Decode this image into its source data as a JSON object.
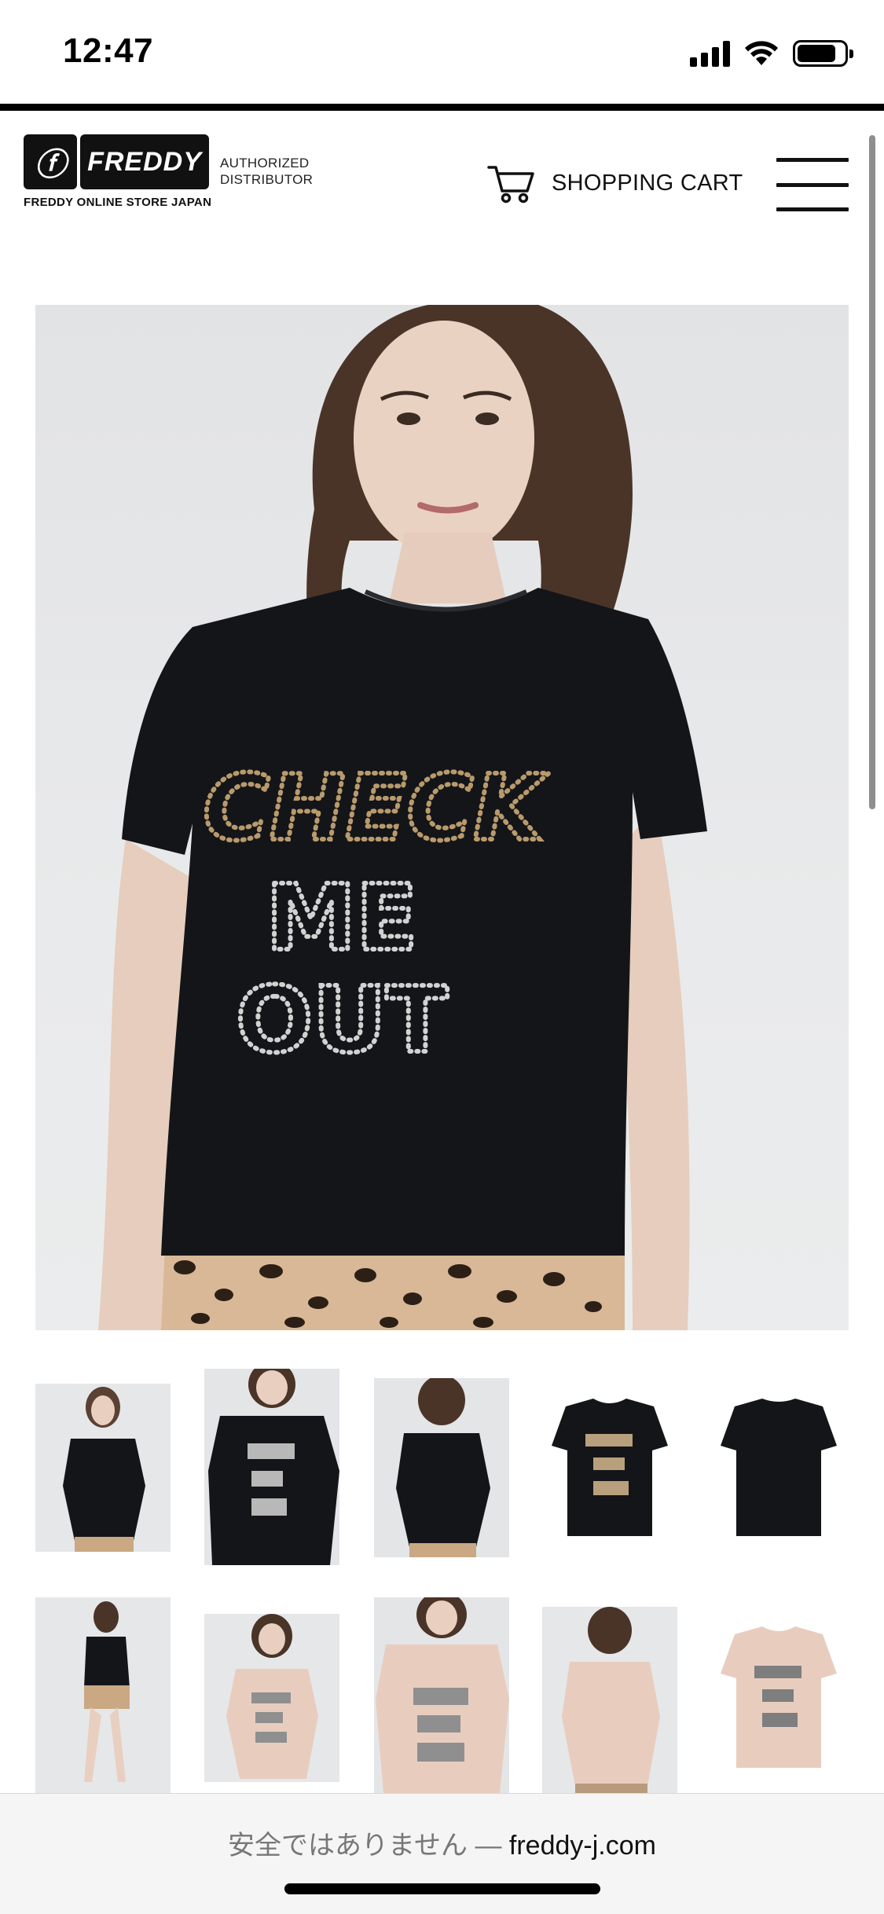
{
  "status_bar": {
    "time": "12:47"
  },
  "header": {
    "logo_text": "FREDDY",
    "logo_subtitle": "FREDDY ONLINE STORE JAPAN",
    "authorized_line1": "AUTHORIZED",
    "authorized_line2": "DISTRIBUTOR",
    "cart_label": "SHOPPING CART",
    "menu_icon": "hamburger-menu-icon",
    "cart_icon": "shopping-cart-icon"
  },
  "product": {
    "main_image_print": [
      "CHECK",
      "ME",
      "OUT"
    ],
    "thumbnails": [
      {
        "variant": "black",
        "view": "model-front"
      },
      {
        "variant": "black",
        "view": "model-closeup"
      },
      {
        "variant": "black",
        "view": "model-back"
      },
      {
        "variant": "black",
        "view": "product-front"
      },
      {
        "variant": "black",
        "view": "product-back"
      },
      {
        "variant": "black",
        "view": "model-full"
      },
      {
        "variant": "pink",
        "view": "model-front"
      },
      {
        "variant": "pink",
        "view": "model-closeup"
      },
      {
        "variant": "pink",
        "view": "model-back"
      },
      {
        "variant": "pink",
        "view": "product-front"
      }
    ]
  },
  "browser": {
    "insecure_label": "安全ではありません",
    "separator": "—",
    "domain": "freddy-j.com"
  },
  "colors": {
    "shirt_black": "#141518",
    "shirt_pink": "#e8cdbf",
    "background_gray": "#e7e8ea",
    "accent_text": "#111111"
  }
}
